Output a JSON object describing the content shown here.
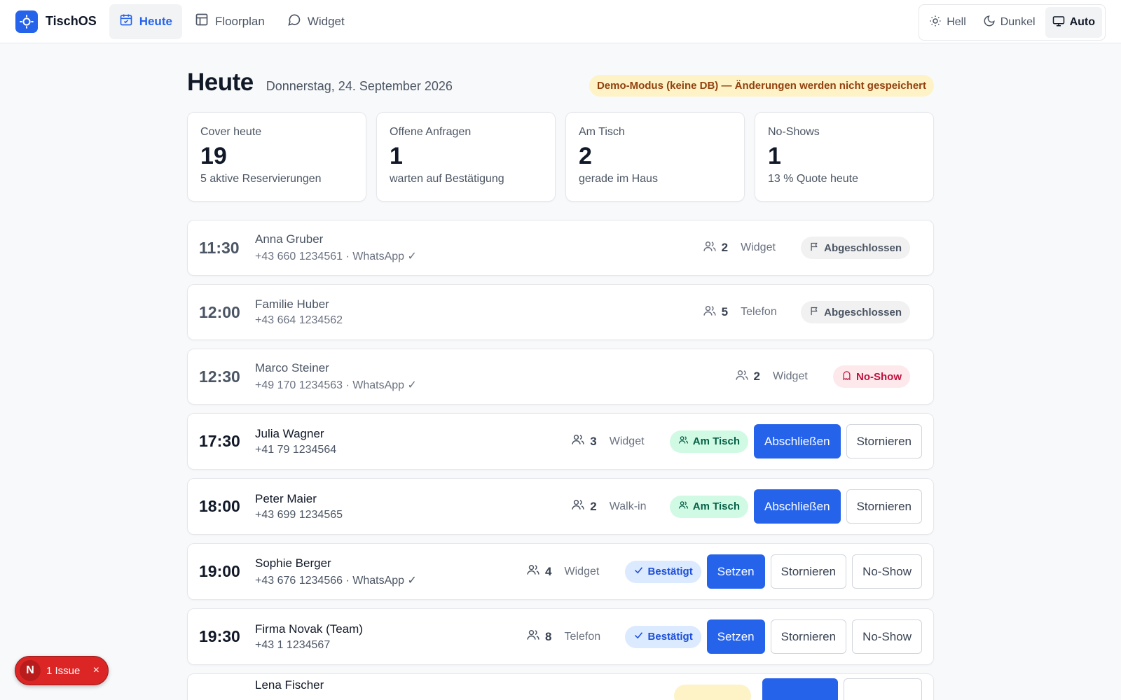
{
  "app": {
    "name": "TischOS",
    "logo_icon": "app-logo-icon",
    "accent": "#2563eb"
  },
  "nav": {
    "tabs": [
      {
        "label": "Heute",
        "icon": "calendar-icon",
        "active": true
      },
      {
        "label": "Floorplan",
        "icon": "layout-icon",
        "active": false
      },
      {
        "label": "Widget",
        "icon": "chat-bubble-icon",
        "active": false
      }
    ]
  },
  "theme": {
    "options": [
      {
        "label": "Hell",
        "icon": "sun-icon",
        "active": false
      },
      {
        "label": "Dunkel",
        "icon": "moon-icon",
        "active": false
      },
      {
        "label": "Auto",
        "icon": "monitor-icon",
        "active": true
      }
    ]
  },
  "header": {
    "title": "Heute",
    "date": "Donnerstag, 24. September 2026",
    "demo_notice": "Demo-Modus (keine DB) — Änderungen werden nicht gespeichert"
  },
  "stats": [
    {
      "label": "Cover heute",
      "value": "19",
      "sub": "5 aktive Reservierungen"
    },
    {
      "label": "Offene Anfragen",
      "value": "1",
      "sub": "warten auf Bestätigung"
    },
    {
      "label": "Am Tisch",
      "value": "2",
      "sub": "gerade im Haus"
    },
    {
      "label": "No-Shows",
      "value": "1",
      "sub": "13 % Quote heute"
    }
  ],
  "reservations": [
    {
      "time": "11:30",
      "name": "Anna Gruber",
      "phone": "+43 660 1234561 · WhatsApp ✓",
      "party": "2",
      "source": "Widget",
      "status": "Abgeschlossen"
    },
    {
      "time": "12:00",
      "name": "Familie Huber",
      "phone": "+43 664 1234562",
      "party": "5",
      "source": "Telefon",
      "status": "Abgeschlossen"
    },
    {
      "time": "12:30",
      "name": "Marco Steiner",
      "phone": "+49 170 1234563 · WhatsApp ✓",
      "party": "2",
      "source": "Widget",
      "status": "No-Show"
    },
    {
      "time": "17:30",
      "name": "Julia Wagner",
      "phone": "+41 79 1234564",
      "party": "3",
      "source": "Widget",
      "status": "Am Tisch",
      "actions": [
        "Abschließen",
        "Stornieren"
      ]
    },
    {
      "time": "18:00",
      "name": "Peter Maier",
      "phone": "+43 699 1234565",
      "party": "2",
      "source": "Walk-in",
      "status": "Am Tisch",
      "actions": [
        "Abschließen",
        "Stornieren"
      ]
    },
    {
      "time": "19:00",
      "name": "Sophie Berger",
      "phone": "+43 676 1234566 · WhatsApp ✓",
      "party": "4",
      "source": "Widget",
      "status": "Bestätigt",
      "actions": [
        "Setzen",
        "Stornieren",
        "No-Show"
      ]
    },
    {
      "time": "19:30",
      "name": "Firma Novak (Team)",
      "phone": "+43 1 1234567",
      "party": "8",
      "source": "Telefon",
      "status": "Bestätigt",
      "actions": [
        "Setzen",
        "Stornieren",
        "No-Show"
      ]
    },
    {
      "name": "Lena Fischer"
    }
  ],
  "issue_badge": {
    "initial": "N",
    "label": "1 Issue",
    "close": "×"
  }
}
